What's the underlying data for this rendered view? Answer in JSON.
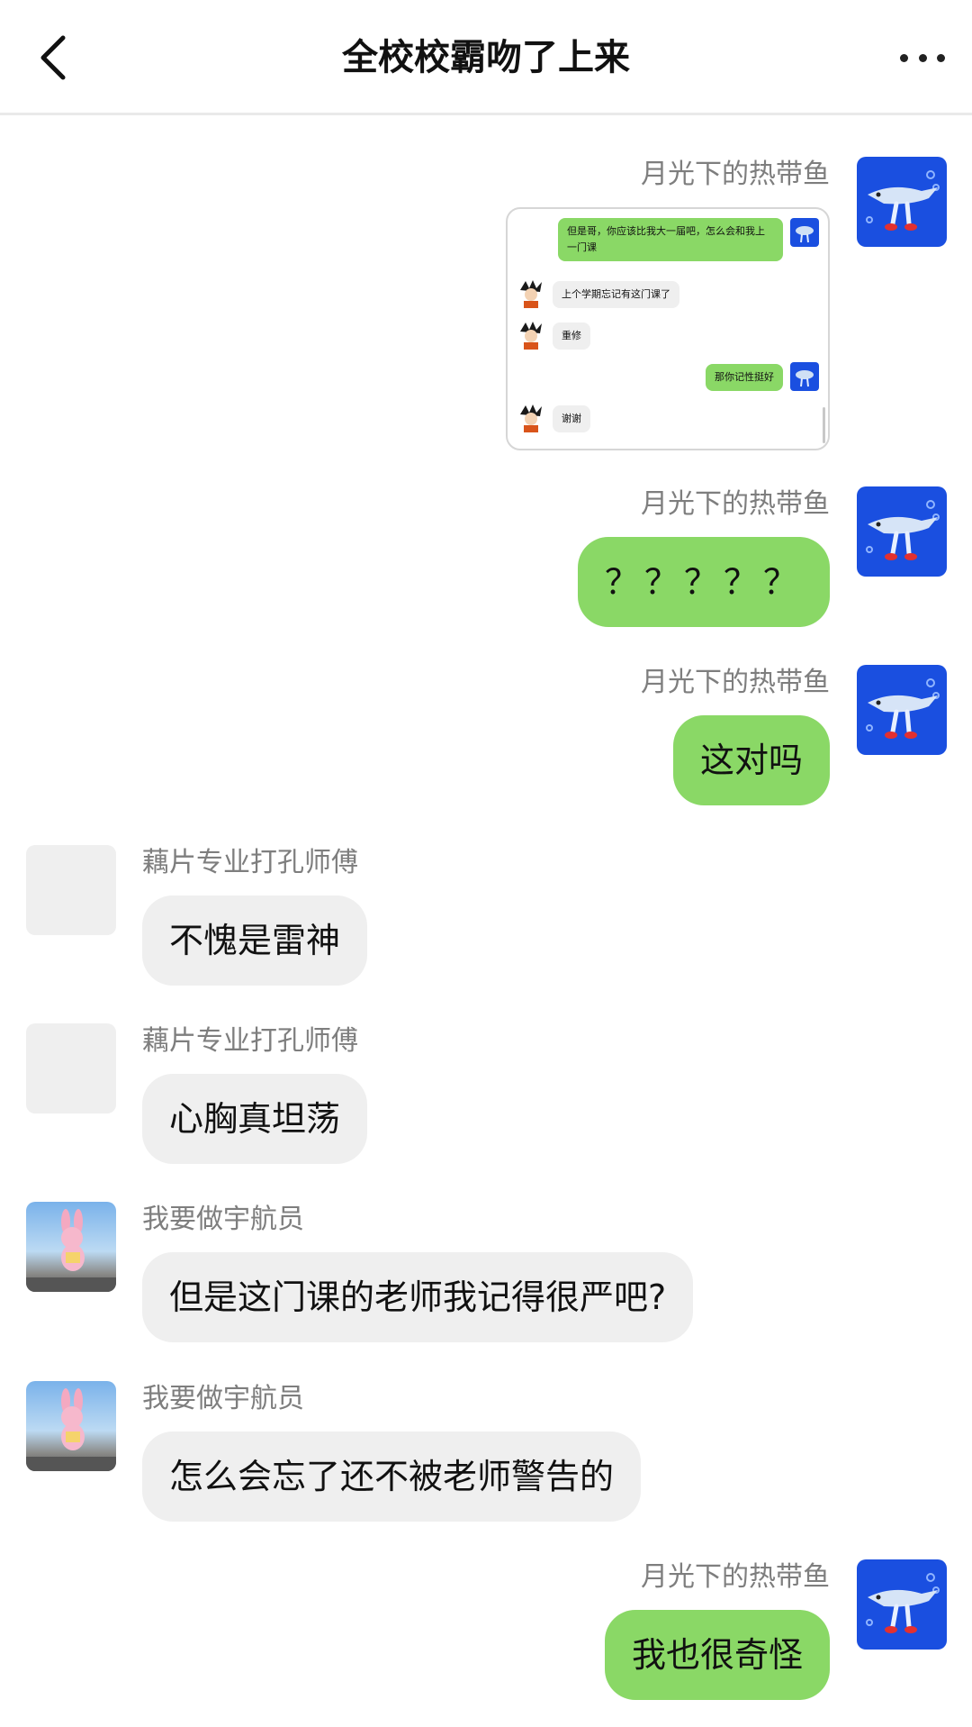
{
  "header": {
    "title": "全校校霸吻了上来"
  },
  "screenshot_chat": [
    {
      "side": "right",
      "text": "但是哥，你应该比我大一届吧，怎么会和我上一门课"
    },
    {
      "side": "left",
      "text": "上个学期忘记有这门课了"
    },
    {
      "side": "left",
      "text": "重修"
    },
    {
      "side": "right",
      "text": "那你记性挺好"
    },
    {
      "side": "left",
      "text": "谢谢"
    }
  ],
  "messages": [
    {
      "side": "right",
      "sender": "月光下的热带鱼",
      "type": "image"
    },
    {
      "side": "right",
      "sender": "月光下的热带鱼",
      "text": "？？？？？"
    },
    {
      "side": "right",
      "sender": "月光下的热带鱼",
      "text": "这对吗"
    },
    {
      "side": "left",
      "sender": "藕片专业打孔师傅",
      "text": "不愧是雷神"
    },
    {
      "side": "left",
      "sender": "藕片专业打孔师傅",
      "text": "心胸真坦荡"
    },
    {
      "side": "left",
      "sender": "我要做宇航员",
      "text": "但是这门课的老师我记得很严吧?"
    },
    {
      "side": "left",
      "sender": "我要做宇航员",
      "text": "怎么会忘了还不被老师警告的"
    },
    {
      "side": "right",
      "sender": "月光下的热带鱼",
      "text": "我也很奇怪"
    }
  ],
  "icons": {
    "back": "chevron-left-icon",
    "more": "more-horizontal-icon",
    "fish_avatar": "tropical-fish-avatar",
    "bunny_avatar": "pink-bunny-avatar"
  },
  "colors": {
    "outgoing_bubble": "#8ad866",
    "incoming_bubble": "#efefef",
    "name_text": "#7e7e7e",
    "fish_avatar_bg": "#1a4fe0"
  }
}
